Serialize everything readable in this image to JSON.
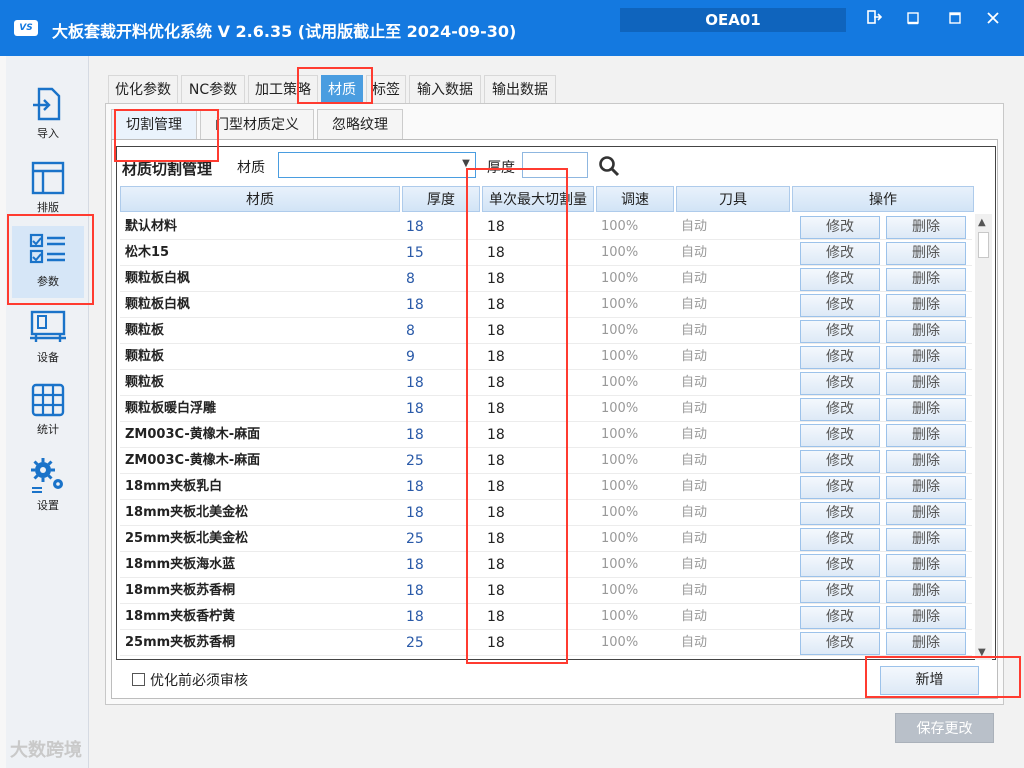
{
  "app": {
    "title": "大板套裁开料优化系统  V 2.6.35  (试用版截止至 2024-09-30)",
    "logo_text": "VS",
    "user_code": "OEA01",
    "window_controls": [
      "logout-icon",
      "restore-icon",
      "maximize-icon",
      "close-icon"
    ]
  },
  "sidebar": {
    "items": [
      {
        "label": "导入",
        "icon": "import-icon"
      },
      {
        "label": "排版",
        "icon": "layout-icon"
      },
      {
        "label": "参数",
        "icon": "params-icon",
        "active": true
      },
      {
        "label": "设备",
        "icon": "machine-icon"
      },
      {
        "label": "统计",
        "icon": "stats-icon"
      },
      {
        "label": "设置",
        "icon": "settings-icon"
      }
    ]
  },
  "top_tabs": [
    "优化参数",
    "NC参数",
    "加工策略",
    "材质",
    "标签",
    "输入数据",
    "输出数据"
  ],
  "active_top_tab": "材质",
  "sub_tabs": [
    "切割管理",
    "门型材质定义",
    "忽略纹理"
  ],
  "active_sub_tab": "切割管理",
  "filter": {
    "section_title": "材质切割管理",
    "material_label": "材质",
    "material_value": "",
    "thickness_label": "厚度",
    "thickness_value": ""
  },
  "table": {
    "headers": [
      "材质",
      "厚度",
      "单次最大切割量",
      "调速",
      "刀具",
      "操作"
    ],
    "edit_label": "修改",
    "delete_label": "删除",
    "rows": [
      {
        "material": "默认材料",
        "thickness": "18",
        "max_cut": "18",
        "speed": "100%",
        "tool": "自动"
      },
      {
        "material": "松木15",
        "thickness": "15",
        "max_cut": "18",
        "speed": "100%",
        "tool": "自动"
      },
      {
        "material": "颗粒板白枫",
        "thickness": "8",
        "max_cut": "18",
        "speed": "100%",
        "tool": "自动"
      },
      {
        "material": "颗粒板白枫",
        "thickness": "18",
        "max_cut": "18",
        "speed": "100%",
        "tool": "自动"
      },
      {
        "material": "颗粒板",
        "thickness": "8",
        "max_cut": "18",
        "speed": "100%",
        "tool": "自动"
      },
      {
        "material": "颗粒板",
        "thickness": "9",
        "max_cut": "18",
        "speed": "100%",
        "tool": "自动"
      },
      {
        "material": "颗粒板",
        "thickness": "18",
        "max_cut": "18",
        "speed": "100%",
        "tool": "自动"
      },
      {
        "material": "颗粒板暖白浮雕",
        "thickness": "18",
        "max_cut": "18",
        "speed": "100%",
        "tool": "自动"
      },
      {
        "material": "ZM003C-黄橡木-麻面",
        "thickness": "18",
        "max_cut": "18",
        "speed": "100%",
        "tool": "自动"
      },
      {
        "material": "ZM003C-黄橡木-麻面",
        "thickness": "25",
        "max_cut": "18",
        "speed": "100%",
        "tool": "自动"
      },
      {
        "material": "18mm夹板乳白",
        "thickness": "18",
        "max_cut": "18",
        "speed": "100%",
        "tool": "自动"
      },
      {
        "material": "18mm夹板北美金松",
        "thickness": "18",
        "max_cut": "18",
        "speed": "100%",
        "tool": "自动"
      },
      {
        "material": "25mm夹板北美金松",
        "thickness": "25",
        "max_cut": "18",
        "speed": "100%",
        "tool": "自动"
      },
      {
        "material": "18mm夹板海水蓝",
        "thickness": "18",
        "max_cut": "18",
        "speed": "100%",
        "tool": "自动"
      },
      {
        "material": "18mm夹板苏香桐",
        "thickness": "18",
        "max_cut": "18",
        "speed": "100%",
        "tool": "自动"
      },
      {
        "material": "18mm夹板香柠黄",
        "thickness": "18",
        "max_cut": "18",
        "speed": "100%",
        "tool": "自动"
      },
      {
        "material": "25mm夹板苏香桐",
        "thickness": "25",
        "max_cut": "18",
        "speed": "100%",
        "tool": "自动"
      }
    ]
  },
  "footer": {
    "review_checkbox_label": "优化前必须审核",
    "review_checked": false,
    "add_label": "新增",
    "save_label": "保存更改"
  },
  "watermark": "大数跨境",
  "colors": {
    "titlebar": "#1479e0",
    "accent": "#4a9de0",
    "highlight": "#ff3b30"
  }
}
